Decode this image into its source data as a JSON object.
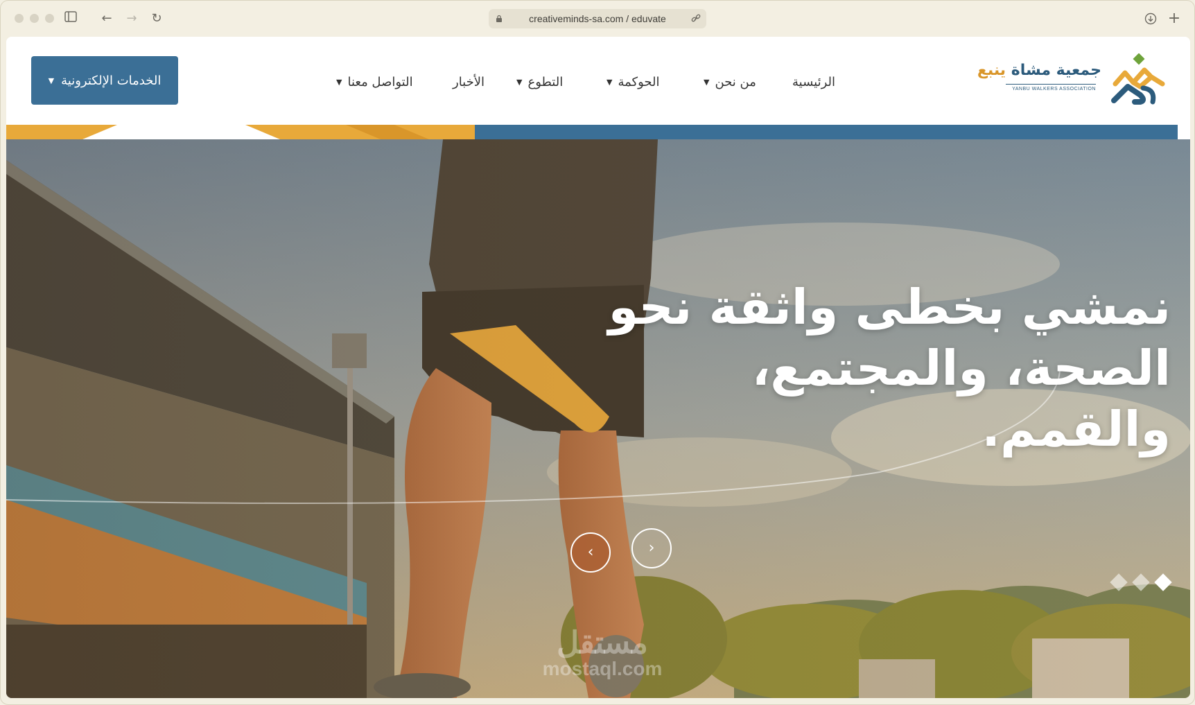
{
  "browser": {
    "url": "creativeminds-sa.com / eduvate"
  },
  "header": {
    "eservices_label": "الخدمات الإلكترونية",
    "nav": [
      {
        "label": "الرئيسية"
      },
      {
        "label": "من نحن"
      },
      {
        "label": "الحوكمة"
      },
      {
        "label": "التطوع"
      },
      {
        "label": "الأخبار"
      },
      {
        "label": "التواصل معنا"
      }
    ],
    "logo": {
      "name_part1": "جمعية مشاة",
      "name_part2": "ينبع",
      "english": "YANBU WALKERS ASSOCIATION"
    }
  },
  "hero": {
    "headline_line1": "نمشي بخطى واثقة نحو",
    "headline_line2": "الصحة، والمجتمع، والقمم.",
    "slides_total": 3,
    "active_slide": 1
  },
  "watermark": {
    "arabic": "مستقل",
    "english": "mostaql.com"
  },
  "colors": {
    "brand_blue": "#3b6f96",
    "brand_orange": "#e8a93a",
    "page_bg": "#f3efe2"
  }
}
